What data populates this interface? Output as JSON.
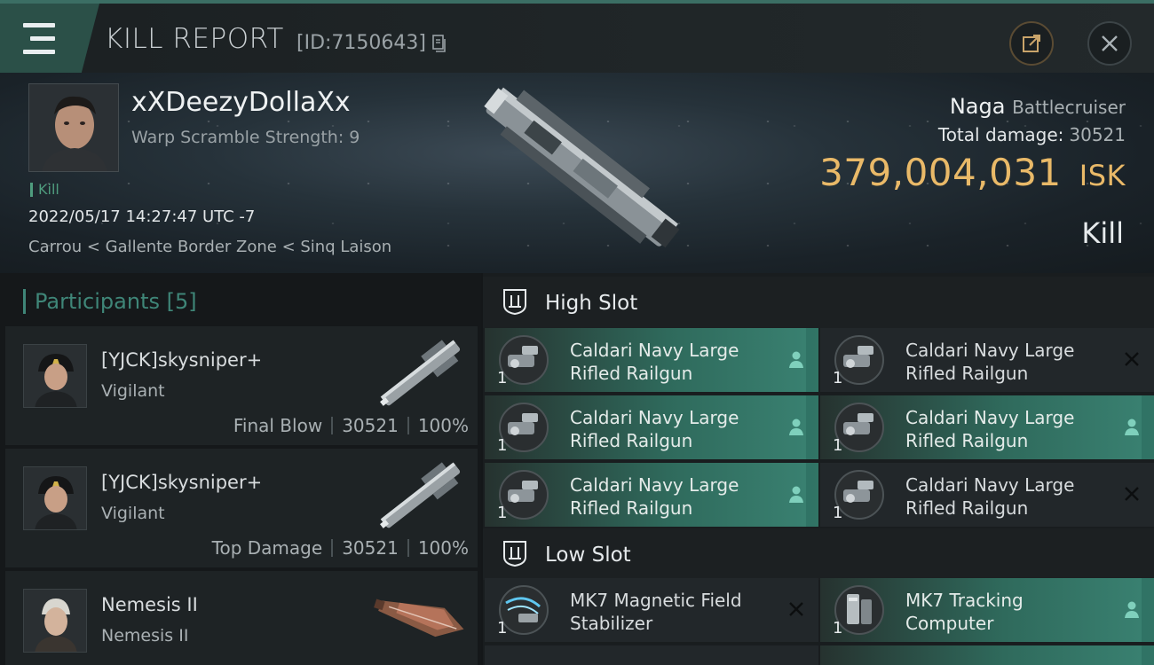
{
  "header": {
    "title": "KILL REPORT",
    "id_label": "[ID:7150643]"
  },
  "victim": {
    "name": "xXDeezyDollaXx",
    "subtitle": "Warp Scramble Strength: 9",
    "tag": "Kill",
    "timestamp": "2022/05/17 14:27:47 UTC -7",
    "location": "Carrou < Gallente Border Zone < Sinq Laison"
  },
  "ship": {
    "name": "Naga",
    "class": "Battlecruiser",
    "total_damage_label": "Total damage:",
    "total_damage": "30521",
    "isk_value": "379,004,031",
    "isk_unit": "ISK",
    "result": "Kill"
  },
  "participants": {
    "label": "Participants",
    "count": "[5]",
    "items": [
      {
        "name": "[YJCK]skysniper+",
        "ship": "Vigilant",
        "role": "Final Blow",
        "damage": "30521",
        "percent": "100%"
      },
      {
        "name": "[YJCK]skysniper+",
        "ship": "Vigilant",
        "role": "Top Damage",
        "damage": "30521",
        "percent": "100%"
      },
      {
        "name": "Nemesis II",
        "ship": "Nemesis II",
        "role": "",
        "damage": "",
        "percent": ""
      }
    ]
  },
  "slots": {
    "high": {
      "label": "High Slot",
      "modules": [
        {
          "name": "Caldari Navy Large Rifled Railgun",
          "line1": "Caldari Navy Large",
          "line2": "Rifled Railgun",
          "qty": "1",
          "state": "fitted"
        },
        {
          "name": "Caldari Navy Large Rifled Railgun",
          "line1": "Caldari Navy Large",
          "line2": "Rifled Railgun",
          "qty": "1",
          "state": "destroyed"
        },
        {
          "name": "Caldari Navy Large Rifled Railgun",
          "line1": "Caldari Navy Large",
          "line2": "Rifled Railgun",
          "qty": "1",
          "state": "fitted"
        },
        {
          "name": "Caldari Navy Large Rifled Railgun",
          "line1": "Caldari Navy Large",
          "line2": "Rifled Railgun",
          "qty": "1",
          "state": "fitted"
        },
        {
          "name": "Caldari Navy Large Rifled Railgun",
          "line1": "Caldari Navy Large",
          "line2": "Rifled Railgun",
          "qty": "1",
          "state": "fitted"
        },
        {
          "name": "Caldari Navy Large Rifled Railgun",
          "line1": "Caldari Navy Large",
          "line2": "Rifled Railgun",
          "qty": "1",
          "state": "destroyed"
        }
      ]
    },
    "low": {
      "label": "Low Slot",
      "modules": [
        {
          "name": "MK7 Magnetic Field Stabilizer",
          "line1": "MK7 Magnetic Field",
          "line2": "Stabilizer",
          "qty": "1",
          "state": "destroyed"
        },
        {
          "name": "MK7 Tracking Computer",
          "line1": "MK7 Tracking",
          "line2": "Computer",
          "qty": "1",
          "state": "fitted"
        }
      ]
    }
  },
  "colors": {
    "accent_teal": "#3f8678",
    "isk_gold": "#e9b968",
    "fitted_green": "#3a8272"
  },
  "icons": {
    "menu": "hamburger-menu-icon",
    "copy": "copy-icon",
    "share": "share-icon",
    "close": "close-icon",
    "slot": "slot-shield-icon",
    "fitted": "person-icon",
    "destroyed": "x-mark-icon"
  }
}
